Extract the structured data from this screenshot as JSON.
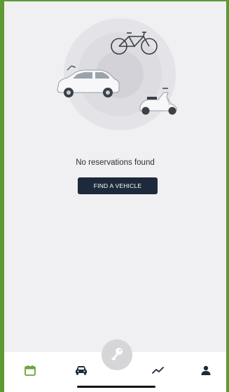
{
  "empty_state": {
    "message": "No reservations found",
    "cta_label": "FIND A VEHICLE",
    "illustration_icons": [
      "bicycle-icon",
      "car-icon",
      "scooter-icon"
    ]
  },
  "tabbar": {
    "tabs": [
      {
        "icon": "calendar-icon",
        "active": true
      },
      {
        "icon": "car-icon",
        "active": false
      },
      {
        "icon": "key-icon",
        "active": false,
        "center": true
      },
      {
        "icon": "trend-chart-icon",
        "active": false
      },
      {
        "icon": "person-icon",
        "active": false
      }
    ]
  },
  "colors": {
    "accent": "#6aa53a",
    "button_bg": "#1d2a3b",
    "icon_inactive": "#1d2a3b",
    "background": "#f0f0f3"
  }
}
